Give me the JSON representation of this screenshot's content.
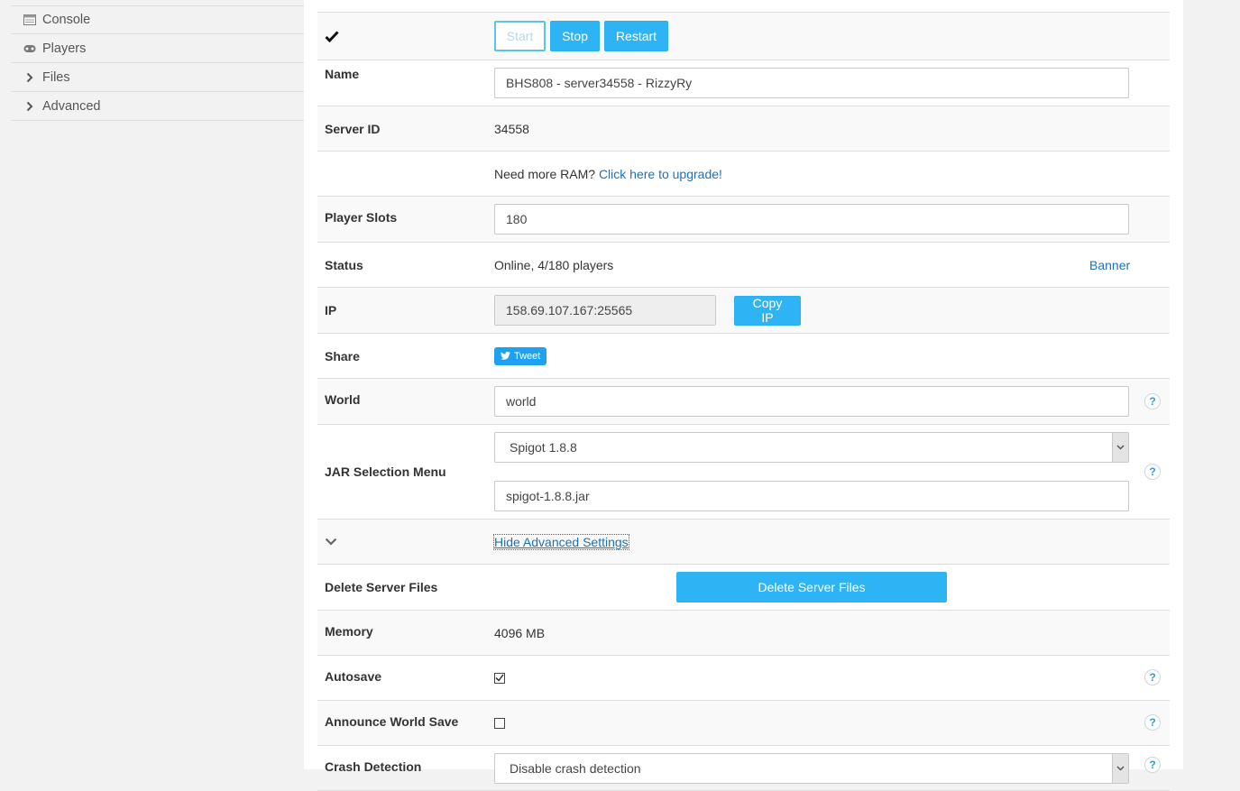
{
  "sidebar": {
    "items": [
      {
        "label": "Console",
        "icon": "console-icon"
      },
      {
        "label": "Players",
        "icon": "gamepad-icon"
      },
      {
        "label": "Files",
        "icon": "chevron-right-icon"
      },
      {
        "label": "Advanced",
        "icon": "chevron-right-icon"
      }
    ]
  },
  "controls": {
    "start_label": "Start",
    "stop_label": "Stop",
    "restart_label": "Restart"
  },
  "fields": {
    "name_label": "Name",
    "name_value": "BHS808 - server34558 - RizzyRy",
    "server_id_label": "Server ID",
    "server_id_value": "34558",
    "ram_text": "Need more RAM?",
    "ram_link": "Click here to upgrade!",
    "player_slots_label": "Player Slots",
    "player_slots_value": "180",
    "status_label": "Status",
    "status_value": "Online, 4/180 players",
    "banner_link": "Banner",
    "ip_label": "IP",
    "ip_value": "158.69.107.167:25565",
    "copy_ip_label": "Copy IP",
    "share_label": "Share",
    "tweet_label": "Tweet",
    "world_label": "World",
    "world_value": "world",
    "jar_label": "JAR Selection Menu",
    "jar_selected": "Spigot 1.8.8",
    "jar_file": "spigot-1.8.8.jar",
    "hide_advanced_link": "Hide Advanced Settings",
    "delete_label": "Delete Server Files",
    "delete_button": "Delete Server Files",
    "memory_label": "Memory",
    "memory_value": "4096 MB",
    "autosave_label": "Autosave",
    "announce_label": "Announce World Save",
    "crash_label": "Crash Detection",
    "crash_value": "Disable crash detection"
  },
  "colors": {
    "accent": "#2eb3f4",
    "link": "#1a72b8"
  }
}
